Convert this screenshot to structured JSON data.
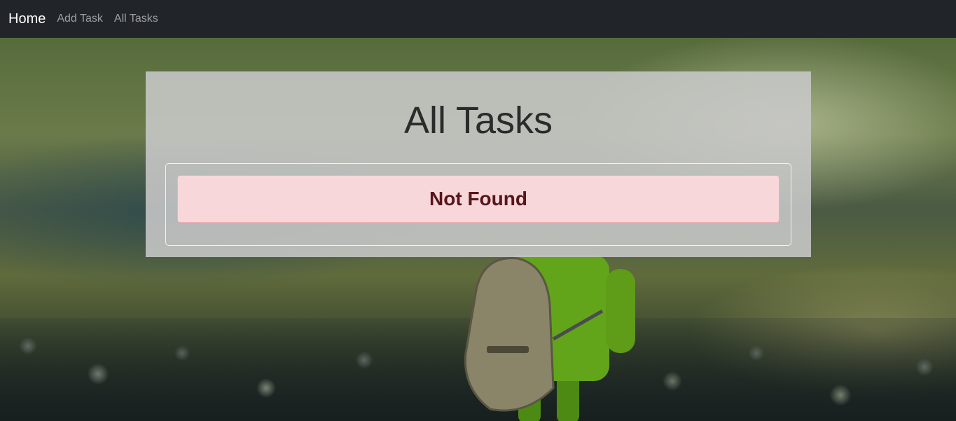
{
  "navbar": {
    "brand": "Home",
    "links": [
      "Add Task",
      "All Tasks"
    ]
  },
  "main": {
    "title": "All Tasks",
    "alert": "Not Found"
  },
  "colors": {
    "navbar_bg": "#212529",
    "alert_bg": "#f8d7da",
    "alert_text": "#58151c"
  }
}
